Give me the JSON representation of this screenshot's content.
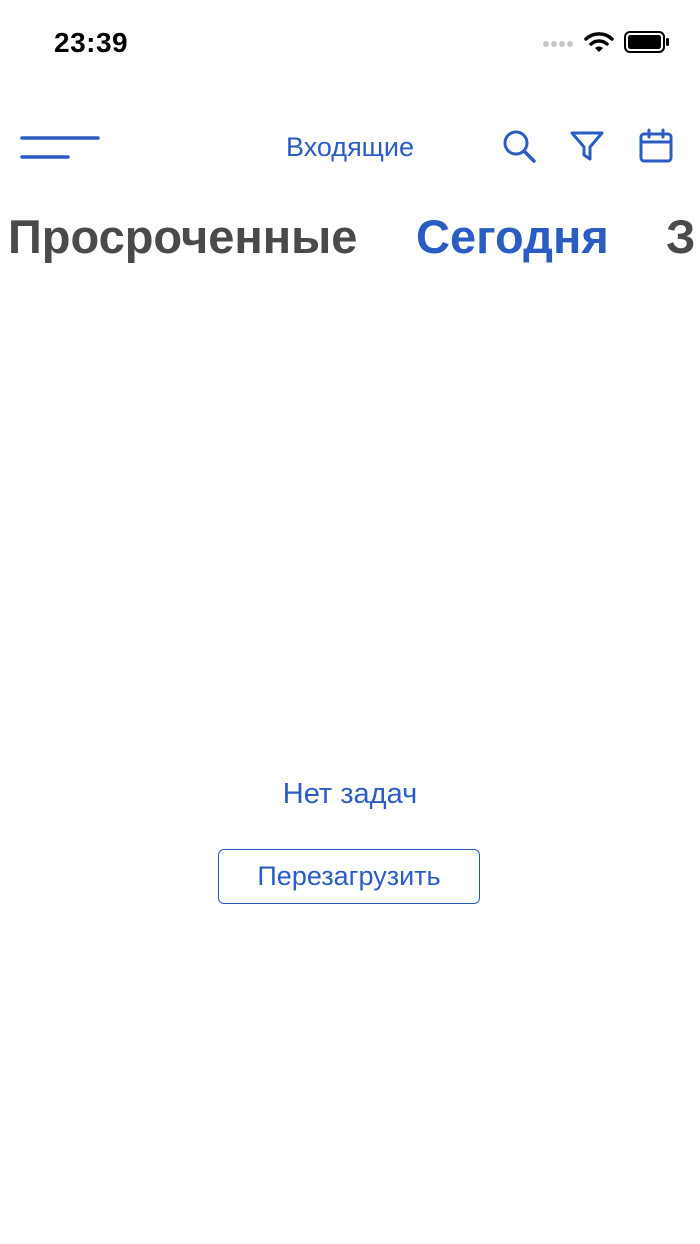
{
  "status_bar": {
    "time": "23:39",
    "icons": [
      "cellular-signal-icon",
      "wifi-icon",
      "battery-icon"
    ]
  },
  "header": {
    "title": "Входящие",
    "menu_icon": "menu-icon",
    "actions": [
      "search-icon",
      "filter-icon",
      "calendar-icon"
    ]
  },
  "tabs": [
    {
      "label": "Просроченные",
      "active": false
    },
    {
      "label": "Сегодня",
      "active": true
    },
    {
      "label": "З",
      "active": false
    }
  ],
  "main": {
    "empty_message": "Нет задач",
    "reload_label": "Перезагрузить"
  },
  "colors": {
    "accent": "#2b5cc4",
    "tab_inactive": "#4a4a4a",
    "background": "#ffffff"
  }
}
